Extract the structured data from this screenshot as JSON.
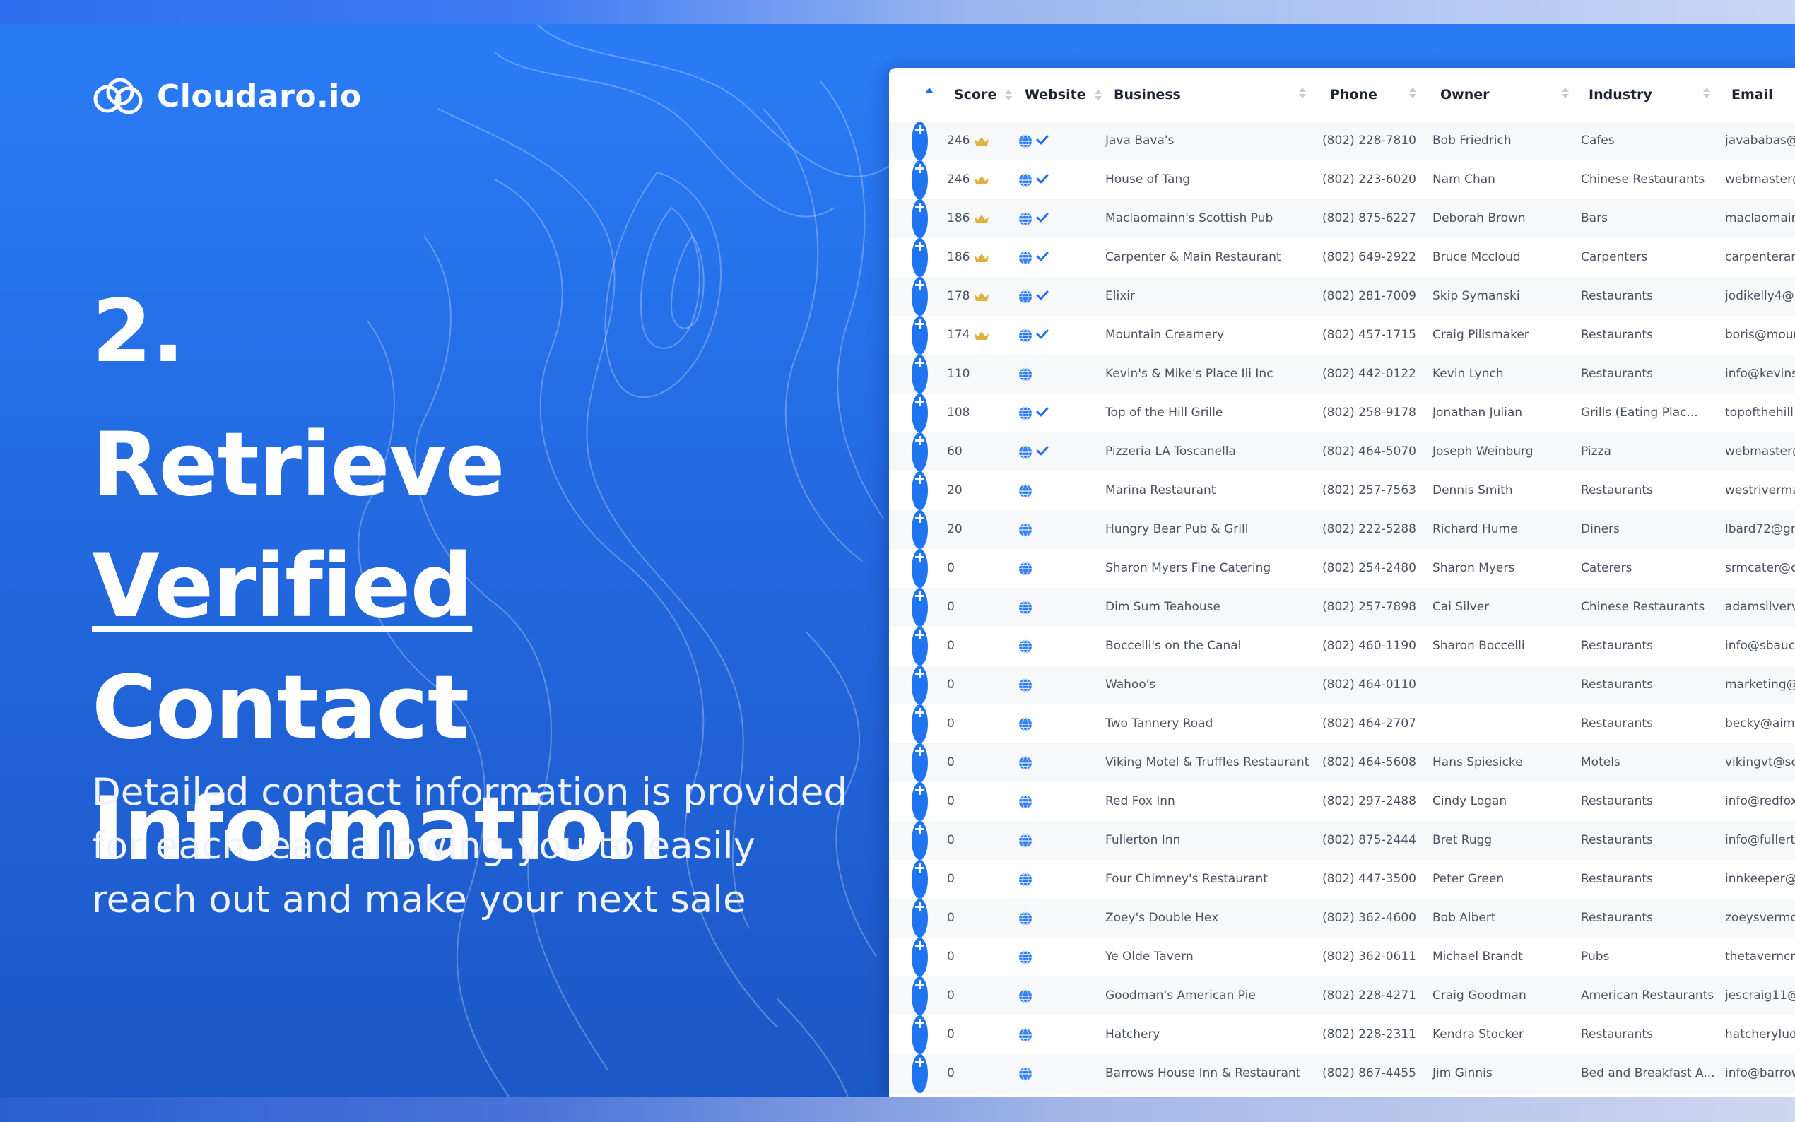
{
  "brand": {
    "name": "Cloudaro.io",
    "logo_icon": "cloud-rings-icon"
  },
  "hero": {
    "step": "2.",
    "headline_line1_a": "Retrieve ",
    "headline_line1_b": "Verified",
    "headline_line2": "Contact",
    "headline_line3": "Information",
    "description": "Detailed contact information is provided for each lead allowing you to easily reach out and make your next sale"
  },
  "colors": {
    "accent": "#1f74f0",
    "background": "#2369e0",
    "crown": "#e0b040",
    "check": "#1f6ff0"
  },
  "table": {
    "columns": [
      "Score",
      "Website",
      "Business",
      "Phone",
      "Owner",
      "Industry",
      "Email"
    ],
    "rows": [
      {
        "score": "246",
        "crown": true,
        "verified": true,
        "business": "Java Bava's",
        "phone": "(802) 228-7810",
        "owner": "Bob Friedrich",
        "industry": "Cafes",
        "email": "javababas@"
      },
      {
        "score": "246",
        "crown": true,
        "verified": true,
        "business": "House of Tang",
        "phone": "(802) 223-6020",
        "owner": "Nam Chan",
        "industry": "Chinese Restaurants",
        "email": "webmaster@"
      },
      {
        "score": "186",
        "crown": true,
        "verified": true,
        "business": "Maclaomainn's Scottish Pub",
        "phone": "(802) 875-6227",
        "owner": "Deborah Brown",
        "industry": "Bars",
        "email": "maclaomain"
      },
      {
        "score": "186",
        "crown": true,
        "verified": true,
        "business": "Carpenter & Main Restaurant",
        "phone": "(802) 649-2922",
        "owner": "Bruce Mccloud",
        "industry": "Carpenters",
        "email": "carpenteran"
      },
      {
        "score": "178",
        "crown": true,
        "verified": true,
        "business": "Elixir",
        "phone": "(802) 281-7009",
        "owner": "Skip Symanski",
        "industry": "Restaurants",
        "email": "jodikelly4@"
      },
      {
        "score": "174",
        "crown": true,
        "verified": true,
        "business": "Mountain Creamery",
        "phone": "(802) 457-1715",
        "owner": "Craig Pillsmaker",
        "industry": "Restaurants",
        "email": "boris@moun"
      },
      {
        "score": "110",
        "crown": false,
        "verified": false,
        "business": "Kevin's & Mike's Place Iii Inc",
        "phone": "(802) 442-0122",
        "owner": "Kevin Lynch",
        "industry": "Restaurants",
        "email": "info@kevins"
      },
      {
        "score": "108",
        "crown": false,
        "verified": true,
        "business": "Top of the Hill Grille",
        "phone": "(802) 258-9178",
        "owner": "Jonathan Julian",
        "industry": "Grills (Eating Plac...",
        "email": "topofthehill"
      },
      {
        "score": "60",
        "crown": false,
        "verified": true,
        "business": "Pizzeria LA Toscanella",
        "phone": "(802) 464-5070",
        "owner": "Joseph Weinburg",
        "industry": "Pizza",
        "email": "webmaster@"
      },
      {
        "score": "20",
        "crown": false,
        "verified": false,
        "business": "Marina Restaurant",
        "phone": "(802) 257-7563",
        "owner": "Dennis Smith",
        "industry": "Restaurants",
        "email": "westriverma"
      },
      {
        "score": "20",
        "crown": false,
        "verified": false,
        "business": "Hungry Bear Pub & Grill",
        "phone": "(802) 222-5288",
        "owner": "Richard Hume",
        "industry": "Diners",
        "email": "lbard72@gn"
      },
      {
        "score": "0",
        "crown": false,
        "verified": false,
        "business": "Sharon Myers Fine Catering",
        "phone": "(802) 254-2480",
        "owner": "Sharon Myers",
        "industry": "Caterers",
        "email": "srmcater@c"
      },
      {
        "score": "0",
        "crown": false,
        "verified": false,
        "business": "Dim Sum Teahouse",
        "phone": "(802) 257-7898",
        "owner": "Cai Silver",
        "industry": "Chinese Restaurants",
        "email": "adamsilverv"
      },
      {
        "score": "0",
        "crown": false,
        "verified": false,
        "business": "Boccelli's on the Canal",
        "phone": "(802) 460-1190",
        "owner": "Sharon Boccelli",
        "industry": "Restaurants",
        "email": "info@sbauct"
      },
      {
        "score": "0",
        "crown": false,
        "verified": false,
        "business": "Wahoo's",
        "phone": "(802) 464-0110",
        "owner": "",
        "industry": "Restaurants",
        "email": "marketing@"
      },
      {
        "score": "0",
        "crown": false,
        "verified": false,
        "business": "Two Tannery Road",
        "phone": "(802) 464-2707",
        "owner": "",
        "industry": "Restaurants",
        "email": "becky@aime"
      },
      {
        "score": "0",
        "crown": false,
        "verified": false,
        "business": "Viking Motel & Truffles Restaurant",
        "phone": "(802) 464-5608",
        "owner": "Hans Spiesicke",
        "industry": "Motels",
        "email": "vikingvt@so"
      },
      {
        "score": "0",
        "crown": false,
        "verified": false,
        "business": "Red Fox Inn",
        "phone": "(802) 297-2488",
        "owner": "Cindy Logan",
        "industry": "Restaurants",
        "email": "info@redfox"
      },
      {
        "score": "0",
        "crown": false,
        "verified": false,
        "business": "Fullerton Inn",
        "phone": "(802) 875-2444",
        "owner": "Bret Rugg",
        "industry": "Restaurants",
        "email": "info@fullert"
      },
      {
        "score": "0",
        "crown": false,
        "verified": false,
        "business": "Four Chimney's Restaurant",
        "phone": "(802) 447-3500",
        "owner": "Peter Green",
        "industry": "Restaurants",
        "email": "innkeeper@"
      },
      {
        "score": "0",
        "crown": false,
        "verified": false,
        "business": "Zoey's Double Hex",
        "phone": "(802) 362-4600",
        "owner": "Bob Albert",
        "industry": "Restaurants",
        "email": "zoeysvermo"
      },
      {
        "score": "0",
        "crown": false,
        "verified": false,
        "business": "Ye Olde Tavern",
        "phone": "(802) 362-0611",
        "owner": "Michael Brandt",
        "industry": "Pubs",
        "email": "thetaverncri"
      },
      {
        "score": "0",
        "crown": false,
        "verified": false,
        "business": "Goodman's American Pie",
        "phone": "(802) 228-4271",
        "owner": "Craig Goodman",
        "industry": "American Restaurants",
        "email": "jescraig11@"
      },
      {
        "score": "0",
        "crown": false,
        "verified": false,
        "business": "Hatchery",
        "phone": "(802) 228-2311",
        "owner": "Kendra Stocker",
        "industry": "Restaurants",
        "email": "hatcheryludl"
      },
      {
        "score": "0",
        "crown": false,
        "verified": false,
        "business": "Barrows House Inn & Restaurant",
        "phone": "(802) 867-4455",
        "owner": "Jim Ginnis",
        "industry": "Bed and Breakfast A...",
        "email": "info@barrow"
      }
    ]
  }
}
